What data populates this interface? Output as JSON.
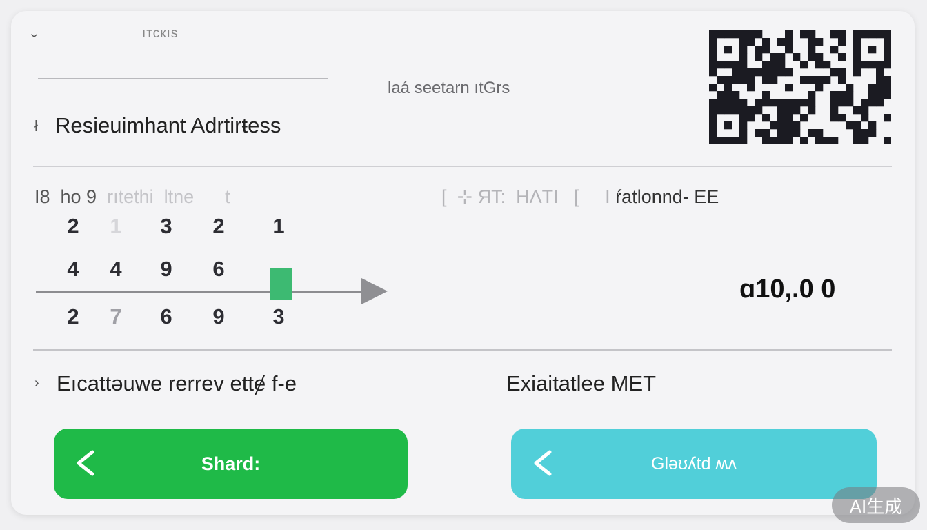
{
  "header": {
    "top_tab": "ıтскıs",
    "subtitle": "laá seetarn ıtGrs",
    "title_mark": "ł",
    "title": "Resieuimhant Adrtirŧess"
  },
  "grid": {
    "header_dark": "I8  ho 9",
    "header_faded": "  rıtethi  ltne      t",
    "rows": [
      [
        {
          "v": "2",
          "s": "dark"
        },
        {
          "v": "1",
          "s": "faint"
        },
        {
          "v": "3",
          "s": "dark"
        },
        {
          "v": "2",
          "s": "dark"
        },
        {
          "v": "1",
          "s": "dark"
        }
      ],
      [
        {
          "v": "4",
          "s": "dark"
        },
        {
          "v": "4",
          "s": "dark"
        },
        {
          "v": "9",
          "s": "dark"
        },
        {
          "v": "6",
          "s": "dark"
        }
      ],
      [
        {
          "v": "2",
          "s": "dark"
        },
        {
          "v": "7",
          "s": "mid"
        },
        {
          "v": "6",
          "s": "dark"
        },
        {
          "v": "9",
          "s": "dark"
        },
        {
          "v": "3",
          "s": "dark"
        }
      ]
    ]
  },
  "right_header": {
    "faded": "[  ⊹ ЯT:  HɅTI   [     I ",
    "dark": "ŕatlonnd- EE"
  },
  "amount": "ɑ10,.0 0",
  "footer": {
    "mark": "›",
    "left_text": "Eıcattəuwe rerrev ettɇ f-e",
    "right_text": "Exiaitatlee MET"
  },
  "buttons": {
    "primary_label": "Shard:",
    "secondary_label": "Gləʊʎtd ʍʌ"
  },
  "watermark": "AI生成",
  "colors": {
    "primary_button": "#1fba48",
    "secondary_button": "#51cfd9",
    "marker": "#3dba72"
  },
  "icons": [
    "chevron-left-icon",
    "back-chevron-icon",
    "qr-code-icon"
  ]
}
